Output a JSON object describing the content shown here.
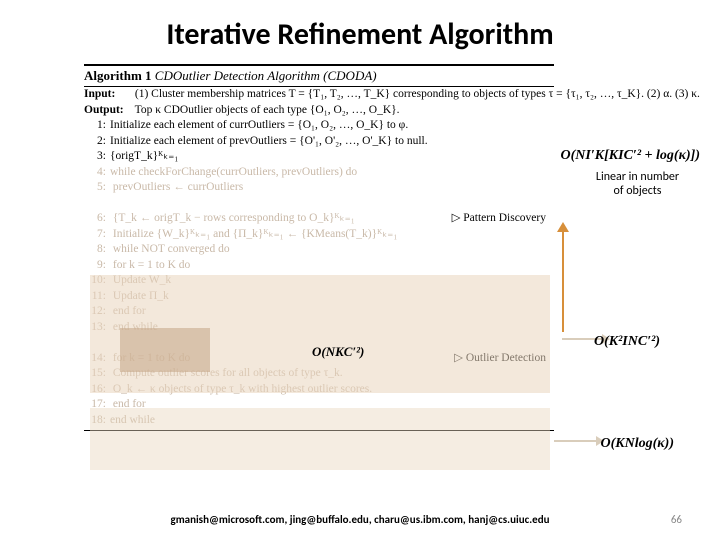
{
  "title": "Iterative Refinement Algorithm",
  "algorithm": {
    "header_label": "Algorithm 1",
    "header_rest": " CDOutlier Detection Algorithm (CDODA)",
    "input_label": "Input:",
    "input_text": " (1) Cluster membership matrices T = {T₁, T₂, …, T_K} corresponding to objects of types τ = {τ₁, τ₂, …, τ_K}. (2) α. (3) κ.",
    "output_label": "Output:",
    "output_text": " Top κ CDOutlier objects of each type {O₁, O₂, …, O_K}.",
    "lines": [
      {
        "n": "1:",
        "t": "Initialize each element of currOutliers = {O₁, O₂, …, O_K} to φ."
      },
      {
        "n": "2:",
        "t": "Initialize each element of prevOutliers = {O'₁, O'₂, …, O'_K} to null."
      },
      {
        "n": "3:",
        "t": "{origT_k}ᴷₖ₌₁"
      },
      {
        "n": "4:",
        "t": "while checkForChange(currOutliers, prevOutliers) do",
        "cls": "faded"
      },
      {
        "n": "5:",
        "t": "   prevOutliers ← currOutliers",
        "cls": "faded"
      },
      {
        "n": "",
        "t": ""
      },
      {
        "n": "6:",
        "t": "   {T_k ← origT_k − rows corresponding to O_k}ᴷₖ₌₁",
        "side": "▷ Pattern Discovery",
        "cls": "faded"
      },
      {
        "n": "7:",
        "t": "   Initialize {W_k}ᴷₖ₌₁ and {Π_k}ᴷₖ₌₁ ← {KMeans(T_k)}ᴷₖ₌₁",
        "cls": "faded"
      },
      {
        "n": "8:",
        "t": "   while NOT converged do",
        "cls": "faded"
      },
      {
        "n": "9:",
        "t": "      for k = 1 to K do",
        "cls": "faded"
      },
      {
        "n": "10:",
        "t": "         Update W_k",
        "cls": "faded"
      },
      {
        "n": "11:",
        "t": "         Update Π_k",
        "cls": "faded"
      },
      {
        "n": "12:",
        "t": "      end for",
        "cls": "faded"
      },
      {
        "n": "13:",
        "t": "   end while",
        "cls": "faded"
      },
      {
        "n": "",
        "t": ""
      },
      {
        "n": "14:",
        "t": "   for k = 1 to K do",
        "side": "▷ Outlier Detection",
        "cls": "faded"
      },
      {
        "n": "15:",
        "t": "      Compute outlier scores for all objects of type τ_k.",
        "cls": "faded"
      },
      {
        "n": "16:",
        "t": "      O_k ← κ objects of type τ_k with highest outlier scores.",
        "cls": "faded"
      },
      {
        "n": "17:",
        "t": "   end for",
        "cls": "faded"
      },
      {
        "n": "18:",
        "t": "end while",
        "cls": "faded"
      }
    ]
  },
  "annotations": {
    "top": "O(NI′K[KIC′² + log(κ)])",
    "linear": "Linear in number of objects",
    "inner": "O(NKC′²)",
    "mid": "O(K²INC′²)",
    "bot": "O(KNlog(κ))"
  },
  "footer": "gmanish@microsoft.com, jing@buffalo.edu, charu@us.ibm.com, hanj@cs.uiuc.edu",
  "page": "66"
}
